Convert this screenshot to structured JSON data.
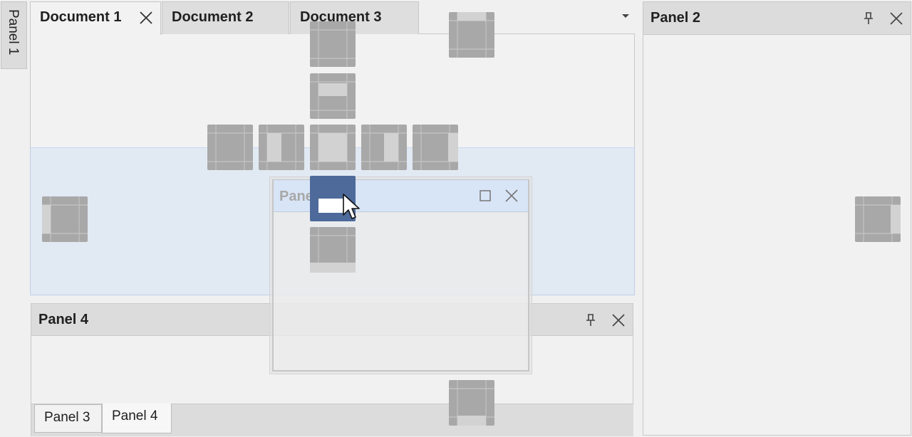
{
  "side_panel": {
    "label": "Panel 1"
  },
  "documents": {
    "tabs": [
      {
        "label": "Document 1",
        "active": true,
        "closable": true
      },
      {
        "label": "Document 2",
        "active": false
      },
      {
        "label": "Document 3",
        "active": false
      }
    ],
    "overflow_icon": "chevron-down-icon"
  },
  "panel2": {
    "title": "Panel 2",
    "buttons": [
      "pin-icon",
      "close-icon"
    ]
  },
  "panel4": {
    "title": "Panel 4",
    "buttons": [
      "pin-icon",
      "close-icon"
    ],
    "tabs": [
      {
        "label": "Panel 3",
        "active": false
      },
      {
        "label": "Panel 4",
        "active": true
      }
    ]
  },
  "floating_panel": {
    "title": "Pane",
    "buttons": [
      "maximize-icon",
      "close-icon"
    ]
  },
  "dock_guides": {
    "active": "dock-guide-center-bottom",
    "active_color": "#4d6a9b",
    "guide_color": "#a8a8a8"
  }
}
